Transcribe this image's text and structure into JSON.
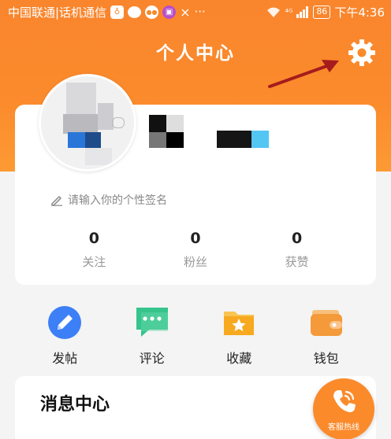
{
  "status_bar": {
    "carrier": "中国联通|话机通信",
    "icons": [
      "lightbulb-icon",
      "chat-icon",
      "app-icon",
      "bookmark-icon",
      "flyme-icon",
      "more-icon"
    ],
    "more": "···",
    "network": "⁴ᴳ",
    "battery": "86",
    "time": "下午4:36"
  },
  "header": {
    "title": "个人中心",
    "settings_icon": "gear-icon"
  },
  "profile": {
    "signature_placeholder": "请输入你的个性签名",
    "stats": [
      {
        "value": "0",
        "label": "关注"
      },
      {
        "value": "0",
        "label": "粉丝"
      },
      {
        "value": "0",
        "label": "获赞"
      }
    ]
  },
  "actions": [
    {
      "label": "发帖",
      "icon": "pencil-icon",
      "color": "#3d7ff6"
    },
    {
      "label": "评论",
      "icon": "comment-icon",
      "color": "#35c48b"
    },
    {
      "label": "收藏",
      "icon": "star-folder-icon",
      "color": "#f7b22c"
    },
    {
      "label": "钱包",
      "icon": "wallet-icon",
      "color": "#f49a3a"
    }
  ],
  "message_center": {
    "title": "消息中心"
  },
  "hotline": {
    "label": "客服热线"
  },
  "colors": {
    "brand_orange": "#fb8a2b",
    "card_bg": "#ffffff",
    "page_bg": "#f4f4f4"
  }
}
